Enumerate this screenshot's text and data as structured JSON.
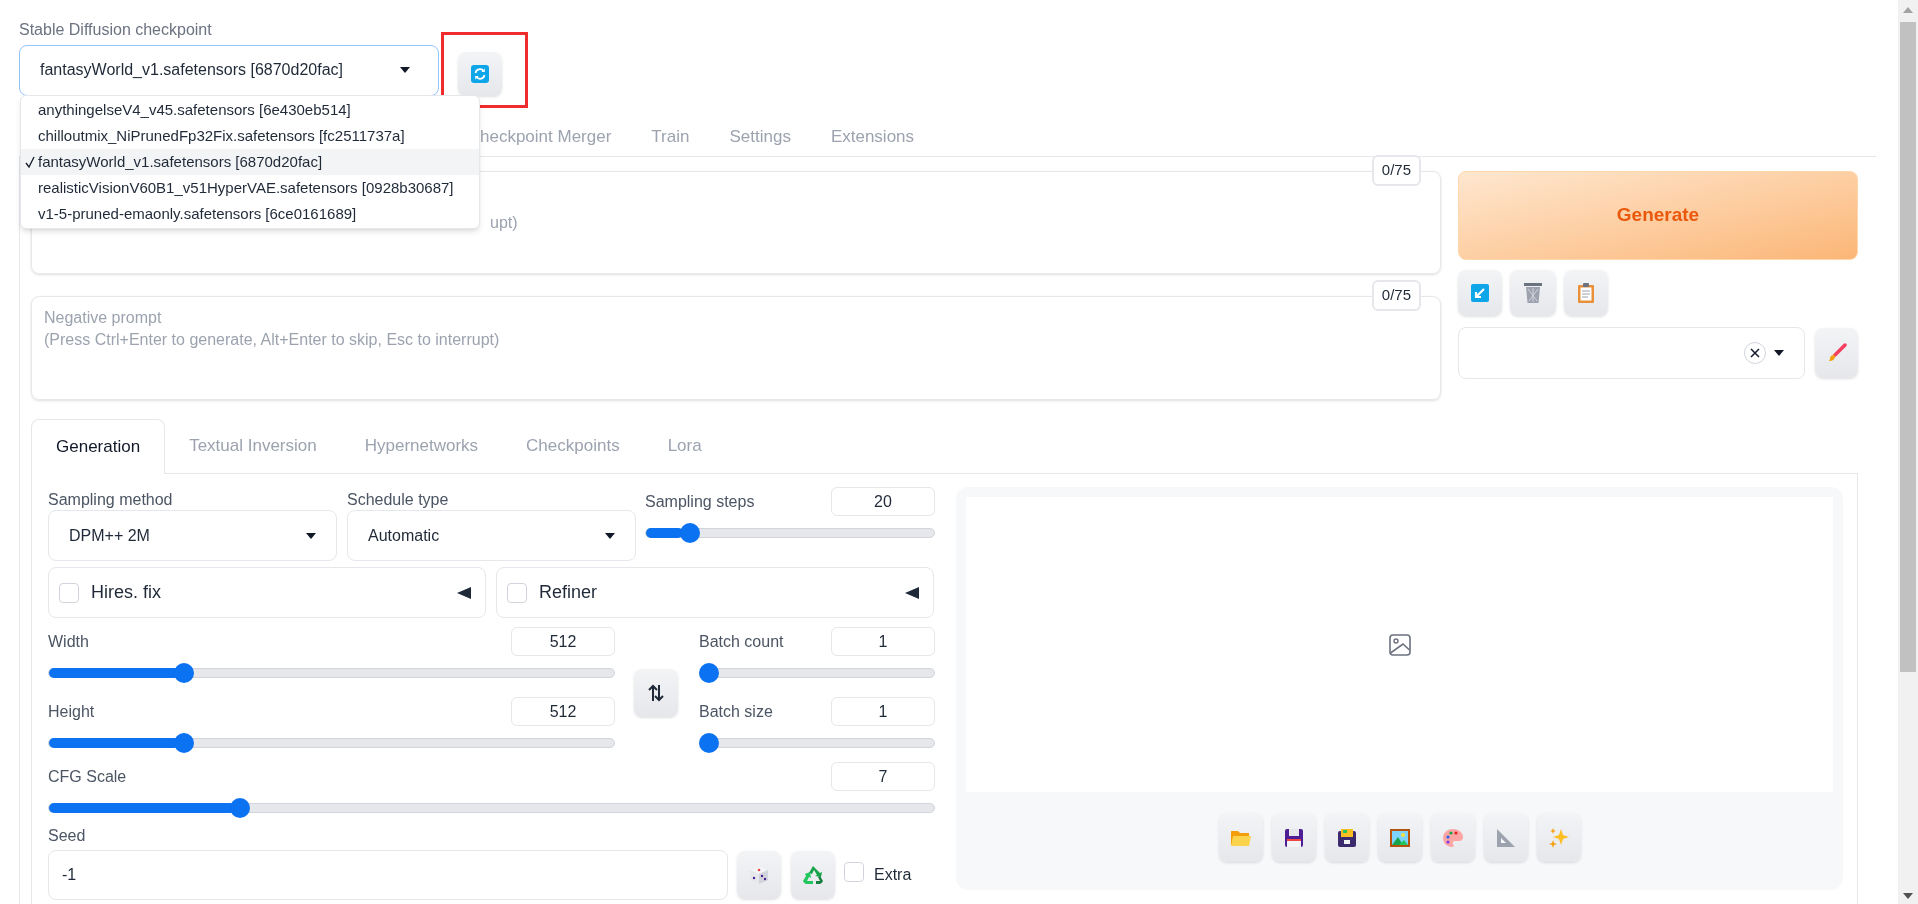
{
  "checkpoint": {
    "label": "Stable Diffusion checkpoint",
    "value": "fantasyWorld_v1.safetensors [6870d20fac]",
    "options": [
      {
        "text": "anythingelseV4_v45.safetensors [6e430eb514]",
        "selected": false
      },
      {
        "text": "chilloutmix_NiPrunedFp32Fix.safetensors [fc2511737a]",
        "selected": false
      },
      {
        "text": "fantasyWorld_v1.safetensors [6870d20fac]",
        "selected": true
      },
      {
        "text": "realisticVisionV60B1_v51HyperVAE.safetensors [0928b30687]",
        "selected": false
      },
      {
        "text": "v1-5-pruned-emaonly.safetensors [6ce0161689]",
        "selected": false
      }
    ]
  },
  "main_tabs": [
    {
      "label": "heckpoint Merger",
      "selected": false
    },
    {
      "label": "Train",
      "selected": false
    },
    {
      "label": "Settings",
      "selected": false
    },
    {
      "label": "Extensions",
      "selected": false
    }
  ],
  "prompt": {
    "placeholder": "upt)",
    "counter": "0/75"
  },
  "negative_prompt": {
    "placeholder": "Negative prompt\n(Press Ctrl+Enter to generate, Alt+Enter to skip, Esc to interrupt)",
    "counter": "0/75"
  },
  "generate_button": "Generate",
  "generation_tabs": [
    {
      "label": "Generation",
      "selected": true
    },
    {
      "label": "Textual Inversion",
      "selected": false
    },
    {
      "label": "Hypernetworks",
      "selected": false
    },
    {
      "label": "Checkpoints",
      "selected": false
    },
    {
      "label": "Lora",
      "selected": false
    }
  ],
  "sampling_method": {
    "label": "Sampling method",
    "value": "DPM++ 2M"
  },
  "schedule_type": {
    "label": "Schedule type",
    "value": "Automatic"
  },
  "sampling_steps": {
    "label": "Sampling steps",
    "value": "20",
    "level": 0.13
  },
  "accordions": [
    {
      "label": "Hires. fix",
      "checked": false
    },
    {
      "label": "Refiner",
      "checked": false
    }
  ],
  "width": {
    "label": "Width",
    "value": "512",
    "level": 0.23
  },
  "height": {
    "label": "Height",
    "value": "512",
    "level": 0.23
  },
  "batch_count": {
    "label": "Batch count",
    "value": "1",
    "level": 0
  },
  "batch_size": {
    "label": "Batch size",
    "value": "1",
    "level": 0
  },
  "cfg_scale": {
    "label": "CFG Scale",
    "value": "7",
    "level": 0.21
  },
  "seed": {
    "label": "Seed",
    "value": "-1"
  },
  "extra": {
    "label": "Extra",
    "checked": false
  }
}
